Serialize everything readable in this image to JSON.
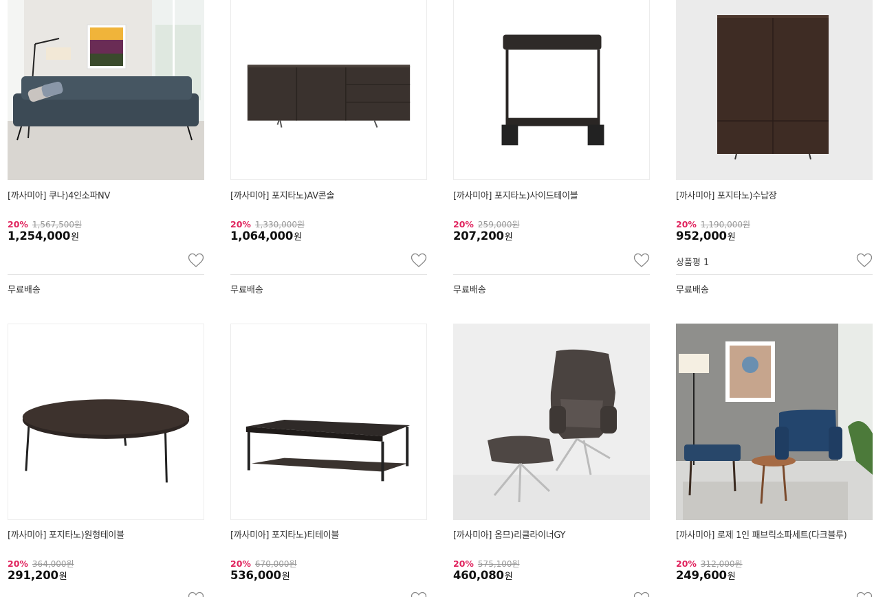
{
  "products": [
    {
      "title": "[까사미아] 쿠나)4인소파NV",
      "discount": "20%",
      "original_price": "1,567,500원",
      "final_price": "1,254,000",
      "won": "원",
      "review": "",
      "shipping": "무료배송",
      "image": "navy-leather-sofa-living-room"
    },
    {
      "title": "[까사미아] 포지타노)AV콘솔",
      "discount": "20%",
      "original_price": "1,330,000원",
      "final_price": "1,064,000",
      "won": "원",
      "review": "",
      "shipping": "무료배송",
      "image": "dark-wood-av-console"
    },
    {
      "title": "[까사미아] 포지타노)사이드테이블",
      "discount": "20%",
      "original_price": "259,000원",
      "final_price": "207,200",
      "won": "원",
      "review": "",
      "shipping": "무료배송",
      "image": "dark-c-side-table"
    },
    {
      "title": "[까사미아] 포지타노)수납장",
      "discount": "20%",
      "original_price": "1,190,000원",
      "final_price": "952,000",
      "won": "원",
      "review": "상품평 1",
      "shipping": "무료배송",
      "image": "dark-wood-cabinet"
    },
    {
      "title": "[까사미아] 포지타노)원형테이블",
      "discount": "20%",
      "original_price": "364,000원",
      "final_price": "291,200",
      "won": "원",
      "review": "",
      "shipping": "",
      "image": "round-coffee-table"
    },
    {
      "title": "[까사미아] 포지타노)티테이블",
      "discount": "20%",
      "original_price": "670,000원",
      "final_price": "536,000",
      "won": "원",
      "review": "",
      "shipping": "",
      "image": "rectangular-tea-table"
    },
    {
      "title": "[까사미아] 옴므)리클라이너GY",
      "discount": "20%",
      "original_price": "575,100원",
      "final_price": "460,080",
      "won": "원",
      "review": "",
      "shipping": "",
      "image": "grey-recliner-with-ottoman"
    },
    {
      "title": "[까사미아] 로제 1인 패브릭소파세트(다크블루)",
      "discount": "20%",
      "original_price": "312,000원",
      "final_price": "249,600",
      "won": "원",
      "review": "",
      "shipping": "",
      "image": "blue-fabric-armchair-set"
    }
  ],
  "colors": {
    "discount": "#e0245e",
    "text": "#222222",
    "muted": "#999999",
    "border": "#ececec"
  },
  "icons": {
    "wishlist": "heart-outline-icon"
  }
}
